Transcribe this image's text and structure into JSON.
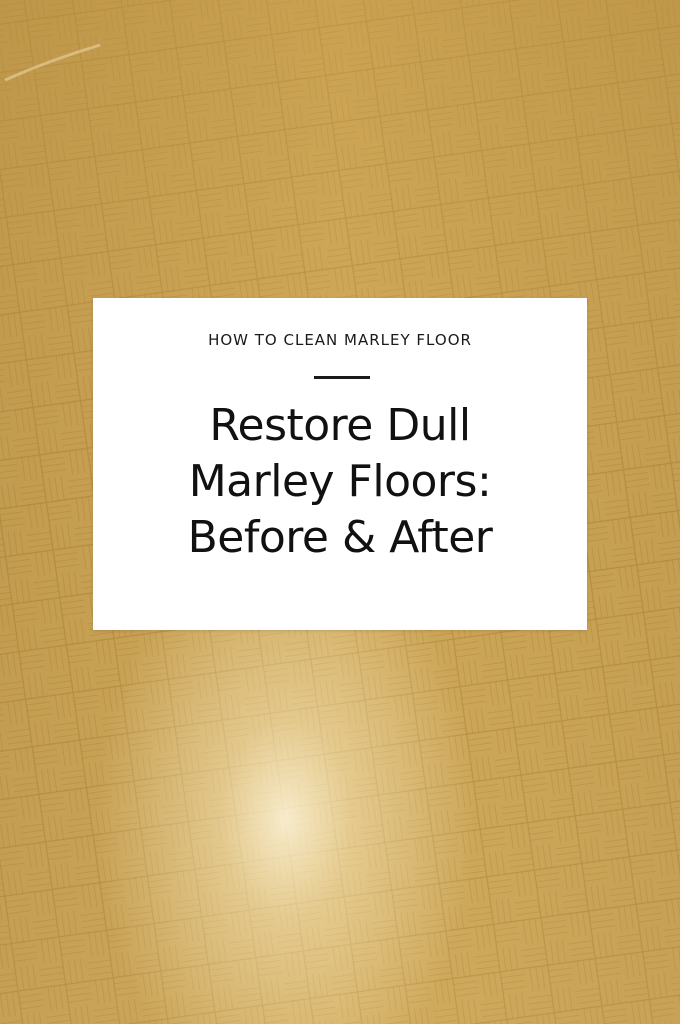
{
  "image": {
    "description_icon": "parquet-floor-photo",
    "floor_color_light": "#d9b868",
    "floor_color_dark": "#b58e3e"
  },
  "card": {
    "kicker": "HOW TO CLEAN MARLEY FLOOR",
    "headline_lines": [
      "Restore Dull",
      "Marley Floors:",
      "Before & After"
    ]
  }
}
